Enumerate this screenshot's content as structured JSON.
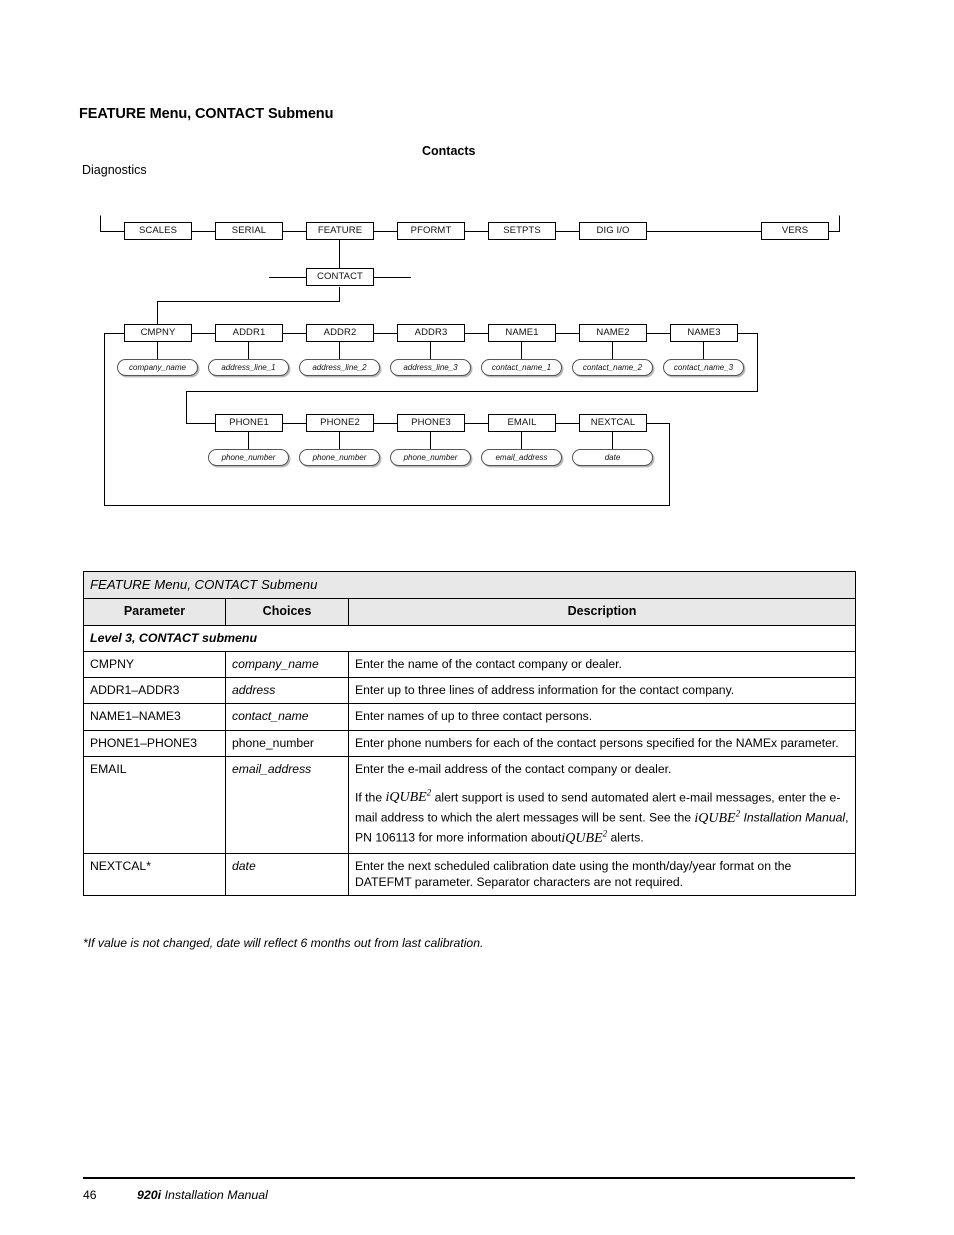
{
  "page": {
    "heading": "FEATURE Menu, CONTACT Submenu",
    "contacts_label": "Contacts",
    "diagnostics_label": "Diagnostics"
  },
  "diagram": {
    "top_row": [
      {
        "label": "SCALES"
      },
      {
        "label": "SERIAL"
      },
      {
        "label": "FEATURE"
      },
      {
        "label": "PFORMT"
      },
      {
        "label": "SETPTS"
      },
      {
        "label": "DIG I/O"
      },
      {
        "label": "VERS"
      }
    ],
    "level2": {
      "label": "CONTACT"
    },
    "row2": [
      {
        "label": "CMPNY",
        "value": "company_name"
      },
      {
        "label": "ADDR1",
        "value": "address_line_1"
      },
      {
        "label": "ADDR2",
        "value": "address_line_2"
      },
      {
        "label": "ADDR3",
        "value": "address_line_3"
      },
      {
        "label": "NAME1",
        "value": "contact_name_1"
      },
      {
        "label": "NAME2",
        "value": "contact_name_2"
      },
      {
        "label": "NAME3",
        "value": "contact_name_3"
      }
    ],
    "row3": [
      {
        "label": "PHONE1",
        "value": "phone_number"
      },
      {
        "label": "PHONE2",
        "value": "phone_number"
      },
      {
        "label": "PHONE3",
        "value": "phone_number"
      },
      {
        "label": "EMAIL",
        "value": "email_address"
      },
      {
        "label": "NEXTCAL",
        "value": "date"
      }
    ]
  },
  "table": {
    "title": "FEATURE Menu, CONTACT Submenu",
    "columns": [
      "Parameter",
      "Choices",
      "Description"
    ],
    "section": "Level 3, CONTACT submenu",
    "rows": [
      {
        "parameter": "CMPNY",
        "choices": "company_name",
        "choices_italic": true,
        "description": [
          "Enter the name of the contact company or dealer."
        ]
      },
      {
        "parameter": "ADDR1–ADDR3",
        "choices": "address",
        "choices_italic": true,
        "description": [
          "Enter up to three lines of address information for the contact company."
        ]
      },
      {
        "parameter": "NAME1–NAME3",
        "choices": "contact_name",
        "choices_italic": true,
        "description": [
          "Enter names of up to three contact persons."
        ]
      },
      {
        "parameter": "PHONE1–PHONE3",
        "choices": "phone_number",
        "choices_italic": false,
        "description": [
          "Enter phone numbers for each of the contact persons specified for the NAMEx parameter."
        ]
      },
      {
        "parameter": "EMAIL",
        "choices": "email_address",
        "choices_italic": true,
        "description": [
          "Enter the e-mail address of the contact company or dealer."
        ],
        "description_rich": {
          "p1_a": "If the ",
          "p1_iqube": "iQUBE",
          "p1_sup": "2",
          "p1_b": " alert support is used to send automated alert e-mail messages, enter the e-mail address to which the alert messages will be sent. See the ",
          "p1_iqube2": "iQUBE",
          "p1_sup2": "2",
          "p1_book": " Installation Manual",
          "p1_c": ", PN 106113 for more information about",
          "p1_iqube3": "iQUBE",
          "p1_sup3": "2",
          "p1_d": " alerts."
        }
      },
      {
        "parameter": "NEXTCAL*",
        "choices": "date",
        "choices_italic": true,
        "description": [
          "Enter the next scheduled calibration date using the month/day/year format on the DATEFMT parameter. Separator characters are not required."
        ]
      }
    ]
  },
  "footnote": "*If value is not changed, date will reflect 6 months out from last calibration.",
  "footer": {
    "page_number": "46",
    "manual_bold": "920i",
    "manual_rest": " Installation Manual"
  }
}
